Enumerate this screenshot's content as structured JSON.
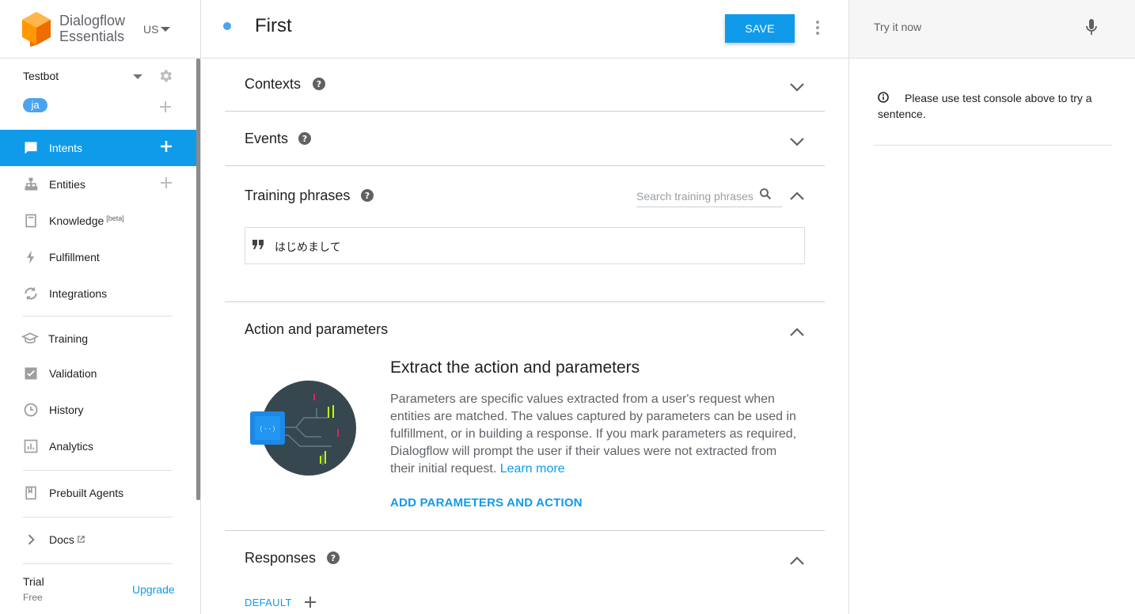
{
  "brand": {
    "line1": "Dialogflow",
    "line2": "Essentials",
    "region": "US"
  },
  "agent": {
    "name": "Testbot",
    "language": "ja"
  },
  "nav": {
    "intents": "Intents",
    "entities": "Entities",
    "knowledge": "Knowledge",
    "knowledge_badge": "[beta]",
    "fulfillment": "Fulfillment",
    "integrations": "Integrations",
    "training": "Training",
    "validation": "Validation",
    "history": "History",
    "analytics": "Analytics",
    "prebuilt": "Prebuilt Agents",
    "docs": "Docs"
  },
  "plan": {
    "name": "Trial",
    "tier": "Free",
    "upgrade": "Upgrade"
  },
  "intent": {
    "title": "First",
    "save_label": "SAVE"
  },
  "sections": {
    "contexts": "Contexts",
    "events": "Events",
    "training": "Training phrases",
    "action": "Action and parameters",
    "responses": "Responses"
  },
  "training": {
    "search_placeholder": "Search training phrases",
    "phrase": "はじめまして"
  },
  "action": {
    "title": "Extract the action and parameters",
    "body": "Parameters are specific values extracted from a user's request when entities are matched. The values captured by parameters can be used in fulfillment, or in building a response. If you mark parameters as required, Dialogflow will prompt the user if their values were not extracted from their initial request.",
    "learn_more": "Learn more",
    "add_button": "ADD PARAMETERS AND ACTION"
  },
  "responses": {
    "default_tab": "DEFAULT"
  },
  "console": {
    "try_placeholder": "Try it now",
    "hint": "Please use test console above to try a sentence."
  },
  "colors": {
    "accent": "#0f9bea",
    "logo": "#ff9800",
    "chip": "#4aa3f0"
  }
}
